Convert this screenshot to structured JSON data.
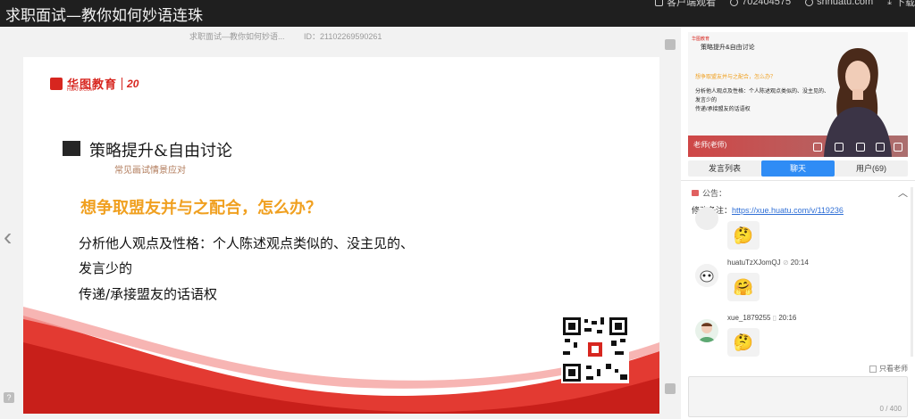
{
  "header": {
    "title": "求职面试—教你如何妙语连珠",
    "client_watch": "客户端观看",
    "room_id": "702404575",
    "domain": "shhuatu.com",
    "download": "下载"
  },
  "stage": {
    "course_name": "求职面试—教你如何妙语...",
    "course_id": "ID：21102269590261",
    "prev": "‹",
    "help": "?"
  },
  "slide": {
    "logo_brand": "华图教育",
    "logo_sub": "HUATU.COM",
    "logo_anniv": "20",
    "section_title": "策略提升&自由讨论",
    "section_sub": "常见画试情景应对",
    "question": "想争取盟友并与之配合，怎么办？",
    "lines": [
      "分析他人观点及性格：个人陈述观点类似的、没主见的、",
      "发言少的",
      "传递/承接盟友的话语权"
    ]
  },
  "video": {
    "logo": "华图教育",
    "title": "策略提升&自由讨论",
    "question": "想争取盟友并与之配合，怎么办？",
    "lines": [
      "分析他人观点及性格：个人陈述观点类似的、没主见的、",
      "发言少的",
      "传递/承接盟友的话语权"
    ],
    "teacher_label": "老师(老师)"
  },
  "tabs": [
    {
      "label": "发言列表",
      "active": false
    },
    {
      "label": "聊天",
      "active": true
    },
    {
      "label": "用户(69)",
      "active": false
    }
  ],
  "notice": {
    "label": "公告：",
    "prefix": "修改备注：",
    "link": "https://xue.huatu.com/v/119236"
  },
  "messages": [
    {
      "user": "",
      "time": "",
      "emoji": "🤔"
    },
    {
      "user": "huatuTzXJomQJ",
      "time": "20:14",
      "emoji": "🤗"
    },
    {
      "user": "xue_1879255",
      "time": "20:16",
      "emoji": "🤔"
    }
  ],
  "chat_input": {
    "teacher_only": "只看老师",
    "counter": "0 / 400"
  },
  "colors": {
    "accent": "#2f8cf5",
    "brand_red": "#d7261f",
    "question_orange": "#f0a020"
  }
}
